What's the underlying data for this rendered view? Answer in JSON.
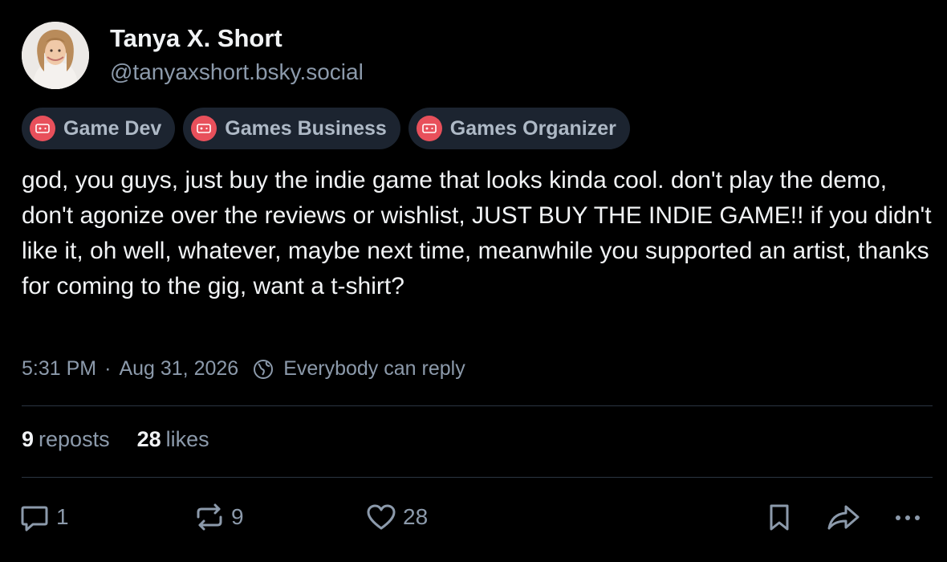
{
  "author": {
    "display_name": "Tanya X. Short",
    "handle": "@tanyaxshort.bsky.social"
  },
  "labels": [
    {
      "text": "Game Dev",
      "icon": "gamepad-icon"
    },
    {
      "text": "Games Business",
      "icon": "gamepad-icon"
    },
    {
      "text": "Games Organizer",
      "icon": "gamepad-icon"
    }
  ],
  "post": {
    "text": "god, you guys, just buy the indie game that looks kinda cool. don't play the demo, don't agonize over the reviews or wishlist, JUST BUY THE INDIE GAME!! if you didn't like it, oh well, whatever, maybe next time, meanwhile you supported an artist, thanks for coming to the gig, want a t-shirt?",
    "time": "5:31 PM",
    "separator": "·",
    "date": "Aug 31, 2026",
    "reply_setting": "Everybody can reply"
  },
  "stats": {
    "reposts_count": "9",
    "reposts_label": "reposts",
    "likes_count": "28",
    "likes_label": "likes"
  },
  "actions": {
    "reply_count": "1",
    "repost_count": "9",
    "like_count": "28"
  },
  "colors": {
    "background": "#000000",
    "primary_text": "#f1f3f5",
    "secondary_text": "#8c9aab",
    "label_chip_bg": "#1c2430",
    "label_icon": "#e8505b",
    "divider": "#2b3542"
  }
}
